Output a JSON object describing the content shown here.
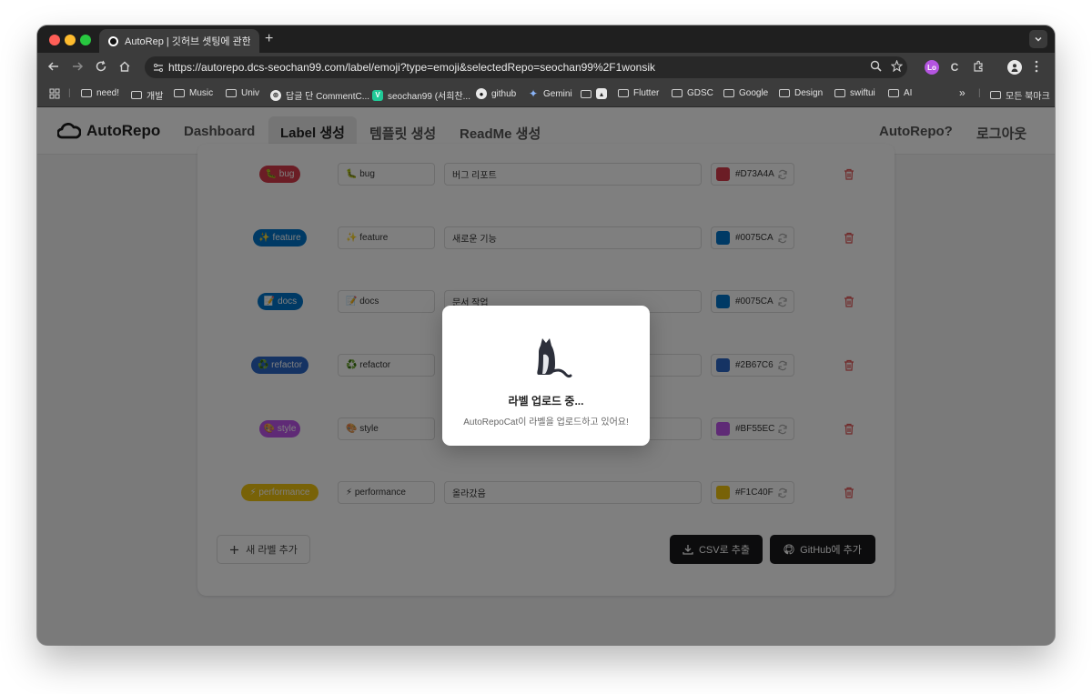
{
  "browser": {
    "tab_title": "AutoRep | 깃허브 셋팅에 관한 모든",
    "url": "https://autorepo.dcs-seochan99.com/label/emoji?type=emoji&selectedRepo=seochan99%2F1wonsik",
    "new_tab_symbol": "+",
    "bookmarks": [
      {
        "label": "need!",
        "icon": "folder-icon"
      },
      {
        "label": "개발",
        "icon": "folder-icon"
      },
      {
        "label": "Music",
        "icon": "folder-icon"
      },
      {
        "label": "Univ",
        "icon": "folder-icon"
      },
      {
        "label": "답글 단 CommentC...",
        "icon": "openai-icon"
      },
      {
        "label": "seochan99 (서희찬...",
        "icon": "velog-icon"
      },
      {
        "label": "github",
        "icon": "github-icon"
      },
      {
        "label": "Gemini",
        "icon": "gemini-icon"
      },
      {
        "label": "Flutter",
        "icon": "folder-icon"
      },
      {
        "label": "GDSC",
        "icon": "folder-icon"
      },
      {
        "label": "Google",
        "icon": "folder-icon"
      },
      {
        "label": "Design",
        "icon": "folder-icon"
      },
      {
        "label": "swiftui",
        "icon": "folder-icon"
      },
      {
        "label": "AI",
        "icon": "folder-icon"
      }
    ],
    "overflow_label": "»",
    "all_bookmarks": "모든 북마크",
    "profile_badge": "Lo",
    "ext_badge": "C"
  },
  "app": {
    "logo": "AutoRepo",
    "nav": [
      {
        "label": "Dashboard",
        "active": false
      },
      {
        "label": "Label 생성",
        "active": true
      },
      {
        "label": "템플릿 생성",
        "active": false
      },
      {
        "label": "ReadMe 생성",
        "active": false
      }
    ],
    "nav_right": [
      "AutoRepo?",
      "로그아웃"
    ]
  },
  "labels": [
    {
      "emoji": "🐛",
      "name": "bug",
      "description": "버그 리포트",
      "color": "#D73A4A"
    },
    {
      "emoji": "✨",
      "name": "feature",
      "description": "새로운 기능",
      "color": "#0075CA"
    },
    {
      "emoji": "📝",
      "name": "docs",
      "description": "문서 작업",
      "color": "#0075CA"
    },
    {
      "emoji": "♻️",
      "name": "refactor",
      "description": "",
      "color": "#2B67C6"
    },
    {
      "emoji": "🎨",
      "name": "style",
      "description": "",
      "color": "#BF55EC"
    },
    {
      "emoji": "⚡",
      "name": "performance",
      "description": "올라갔음",
      "color": "#F1C40F"
    }
  ],
  "actions": {
    "add_label": "새 라벨 추가",
    "export_csv": "CSV로 추출",
    "add_github": "GitHub에 추가"
  },
  "modal": {
    "title": "라벨 업로드 중...",
    "subtitle": "AutoRepoCat이 라벨을 업로드하고 있어요!"
  },
  "colors": {
    "primary_dark": "#18181b",
    "overlay": "rgba(0,0,0,0.5)",
    "delete_icon": "#e05252"
  }
}
